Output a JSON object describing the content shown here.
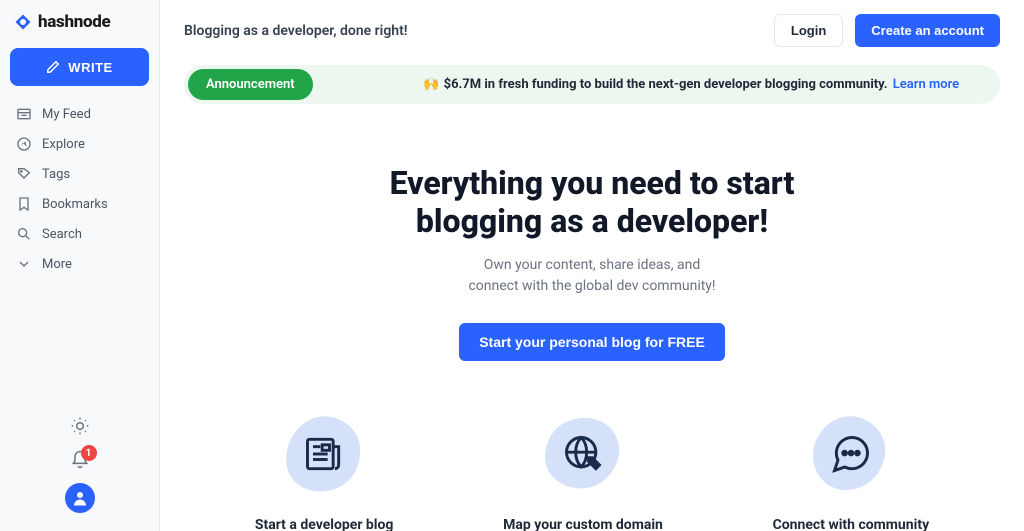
{
  "brand": {
    "name": "hashnode"
  },
  "sidebar": {
    "write_label": "WRITE",
    "items": [
      {
        "label": "My Feed"
      },
      {
        "label": "Explore"
      },
      {
        "label": "Tags"
      },
      {
        "label": "Bookmarks"
      },
      {
        "label": "Search"
      },
      {
        "label": "More"
      }
    ],
    "notification_count": "1"
  },
  "topbar": {
    "tagline": "Blogging as a developer, done right!",
    "login_label": "Login",
    "create_label": "Create an account"
  },
  "announcement": {
    "pill": "Announcement",
    "emoji": "🙌",
    "text": "$6.7M in fresh funding to build the next-gen developer blogging community.",
    "learn_more": "Learn more"
  },
  "hero": {
    "title_line1": "Everything you need to start",
    "title_line2": "blogging as a developer!",
    "sub_line1": "Own your content, share ideas, and",
    "sub_line2": "connect with the global dev community!",
    "cta": "Start your personal blog for FREE"
  },
  "features": [
    {
      "title": "Start a developer blog"
    },
    {
      "title": "Map your custom domain"
    },
    {
      "title": "Connect with community"
    }
  ]
}
